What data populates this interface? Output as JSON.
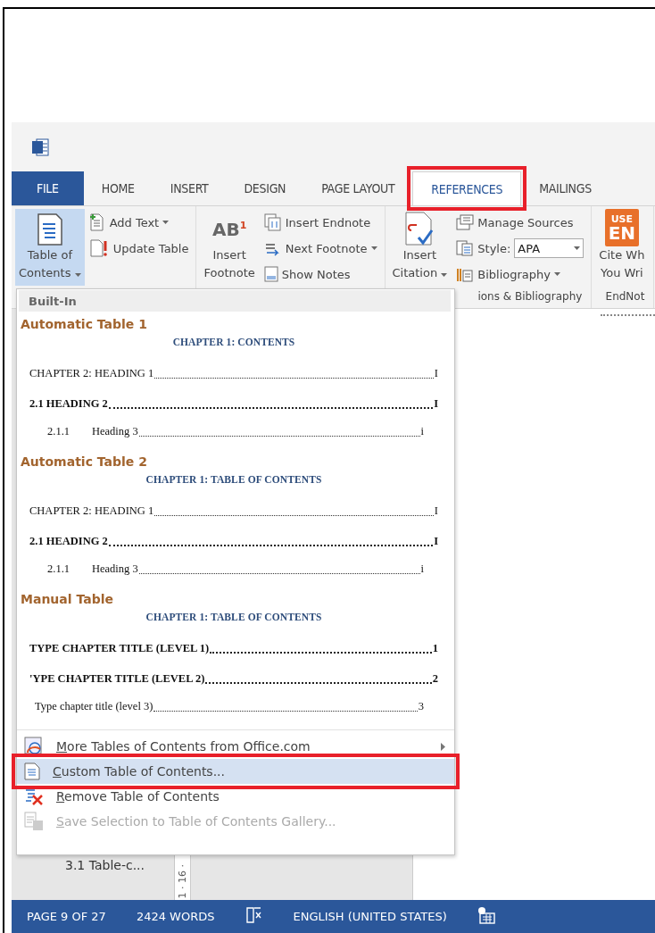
{
  "tabs": [
    {
      "label": "FILE",
      "kind": "file",
      "selected": false,
      "annotated": false
    },
    {
      "label": "HOME",
      "kind": "tab",
      "selected": false,
      "annotated": false
    },
    {
      "label": "INSERT",
      "kind": "tab",
      "selected": false,
      "annotated": false
    },
    {
      "label": "DESIGN",
      "kind": "tab",
      "selected": false,
      "annotated": false
    },
    {
      "label": "PAGE LAYOUT",
      "kind": "tab",
      "selected": false,
      "annotated": false
    },
    {
      "label": "REFERENCES",
      "kind": "tab",
      "selected": true,
      "annotated": true
    },
    {
      "label": "MAILINGS",
      "kind": "tab",
      "selected": false,
      "annotated": false
    }
  ],
  "ribbon": {
    "groups": [
      {
        "large": {
          "kind": "toc",
          "label_lines": [
            "Table of",
            "Contents"
          ],
          "dropdown": true,
          "pressed": true
        },
        "small": [
          {
            "kind": "add-text",
            "label": "Add Text",
            "dropdown": true
          },
          {
            "kind": "update",
            "label": "Update Table",
            "dropdown": false
          }
        ]
      },
      {
        "large": {
          "kind": "footnote",
          "icon_text": "AB$^{1}$",
          "label_lines": [
            "Insert",
            "Footnote"
          ],
          "dropdown": false,
          "pressed": false
        },
        "small": [
          {
            "kind": "endnote",
            "label": "Insert Endnote",
            "dropdown": false
          },
          {
            "kind": "next-footnote",
            "label": "Next Footnote",
            "dropdown": true
          },
          {
            "kind": "show-notes",
            "label": "Show Notes",
            "dropdown": false
          }
        ]
      },
      {
        "label": "ions & Bibliography",
        "large": {
          "kind": "citation",
          "label_lines": [
            "Insert",
            "Citation"
          ],
          "dropdown": true,
          "pressed": false
        },
        "small": [
          {
            "kind": "sources",
            "label": "Manage Sources",
            "dropdown": false
          },
          {
            "kind": "style",
            "label": "Style:",
            "value": "APA",
            "dropdown": false
          },
          {
            "kind": "bibliography",
            "label": "Bibliography",
            "dropdown": true
          }
        ]
      },
      {
        "label": "EndNot",
        "large": {
          "kind": "badge",
          "badge_lines": [
            "USE",
            "EN"
          ],
          "label_lines": [
            "Cite Wh",
            "You Wri"
          ],
          "dropdown": false,
          "pressed": false
        }
      }
    ]
  },
  "nav_pane": {
    "items": [
      {
        "label": "3.1 Table-c..."
      }
    ]
  },
  "ruler": {
    "label": "1 · 16 ·"
  },
  "menu": {
    "header": "Built-In",
    "sections": [
      {
        "title": "Automatic Table 1",
        "preview": {
          "title": "CHAPTER 1: CONTENTS",
          "entries": [
            {
              "kind": "heading1",
              "text": "CHAPTER 2: HEADING 1",
              "page": "I",
              "bold": false
            },
            {
              "kind": "heading2",
              "text": "2.1 HEADING 2",
              "page": "I",
              "bold": true
            },
            {
              "kind": "heading3",
              "number": "2.1.1",
              "text": "Heading 3",
              "page": "i",
              "bold": false
            }
          ]
        }
      },
      {
        "title": "Automatic Table 2",
        "preview": {
          "title": "CHAPTER 1: TABLE OF CONTENTS",
          "entries": [
            {
              "kind": "heading1",
              "text": "CHAPTER 2: HEADING 1",
              "page": "I",
              "bold": false
            },
            {
              "kind": "heading2",
              "text": "2.1 HEADING 2",
              "page": "I",
              "bold": true
            },
            {
              "kind": "heading3",
              "number": "2.1.1",
              "text": "Heading 3",
              "page": "i",
              "bold": false
            }
          ]
        }
      },
      {
        "title": "Manual Table",
        "preview": {
          "title": "CHAPTER 1: TABLE OF CONTENTS",
          "entries": [
            {
              "kind": "heading1",
              "text": "TYPE CHAPTER TITLE (LEVEL 1)",
              "page": "1",
              "bold": true
            },
            {
              "kind": "heading1",
              "text": "'YPE CHAPTER TITLE (LEVEL 2)",
              "page": "2",
              "bold": true
            },
            {
              "kind": "heading3",
              "text": "Type chapter title (level 3)",
              "page": "3",
              "bold": false
            }
          ]
        }
      }
    ],
    "actions": [
      {
        "kind": "more",
        "label": "More Tables of Contents from Office.com",
        "submenu": true,
        "selected": false,
        "annotated": false,
        "disabled": false
      },
      {
        "kind": "custom",
        "label": "Custom Table of Contents...",
        "submenu": false,
        "selected": true,
        "annotated": true,
        "disabled": false
      },
      {
        "kind": "remove",
        "label": "Remove Table of Contents",
        "submenu": false,
        "selected": false,
        "annotated": false,
        "disabled": false
      },
      {
        "kind": "save",
        "label": "Save Selection to Table of Contents Gallery...",
        "submenu": false,
        "selected": false,
        "annotated": false,
        "disabled": true
      }
    ]
  },
  "status_bar": {
    "items": [
      {
        "kind": "text",
        "label": "PAGE 9 OF 27"
      },
      {
        "kind": "text",
        "label": "2424 WORDS"
      },
      {
        "kind": "proofing"
      },
      {
        "kind": "text",
        "label": "ENGLISH (UNITED STATES)"
      },
      {
        "kind": "layout"
      }
    ]
  }
}
